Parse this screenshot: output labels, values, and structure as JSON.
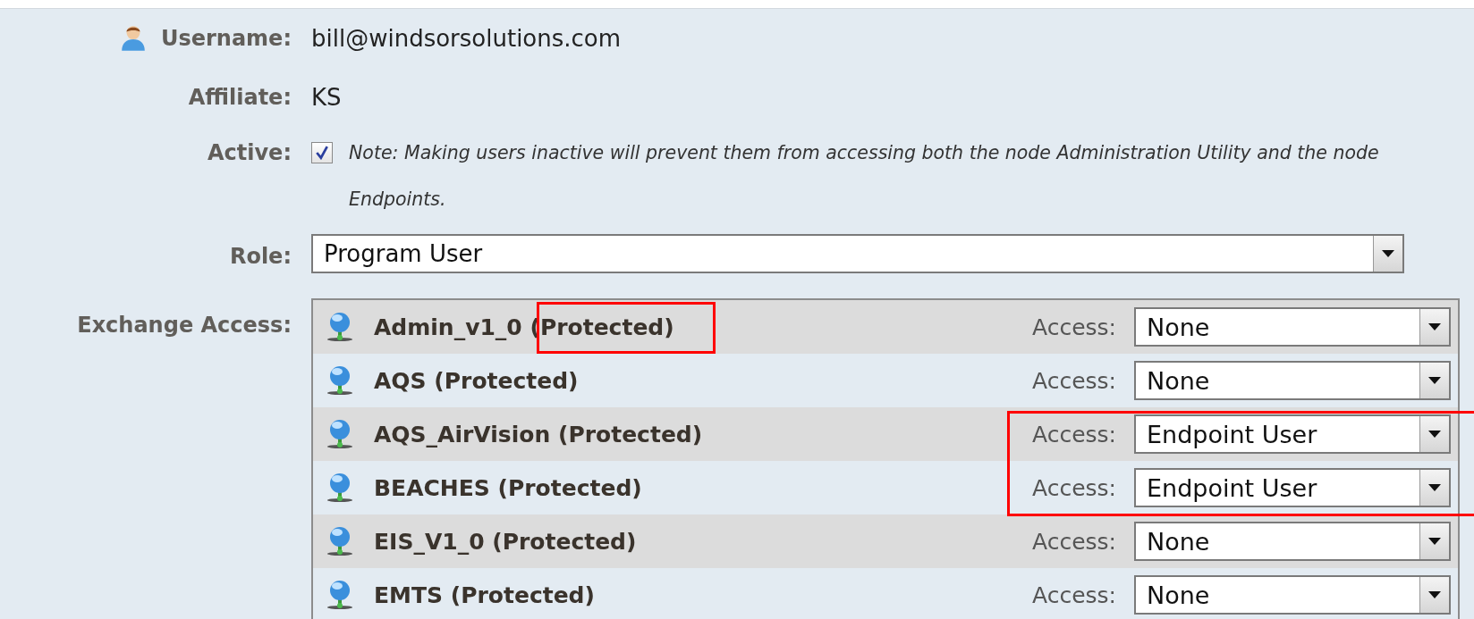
{
  "form": {
    "username": {
      "label": "Username:",
      "value": "bill@windsorsolutions.com"
    },
    "affiliate": {
      "label": "Affiliate:",
      "value": "KS"
    },
    "active": {
      "label": "Active:",
      "checked": true,
      "note": "Note: Making users inactive will prevent them from accessing both the node Administration Utility and the node Endpoints."
    },
    "role": {
      "label": "Role:",
      "value": "Program User"
    },
    "exchange_access": {
      "label": "Exchange Access:",
      "rows": [
        {
          "name": "Admin_v1_0 (Protected)",
          "access_label": "Access:",
          "access": "None",
          "name_framed": true,
          "access_framed": false
        },
        {
          "name": "AQS (Protected)",
          "access_label": "Access:",
          "access": "None",
          "name_framed": false,
          "access_framed": false
        },
        {
          "name": "AQS_AirVision (Protected)",
          "access_label": "Access:",
          "access": "Endpoint User",
          "name_framed": false,
          "access_framed": true
        },
        {
          "name": "BEACHES (Protected)",
          "access_label": "Access:",
          "access": "Endpoint User",
          "name_framed": false,
          "access_framed": true
        },
        {
          "name": "EIS_V1_0 (Protected)",
          "access_label": "Access:",
          "access": "None",
          "name_framed": false,
          "access_framed": false
        },
        {
          "name": "EMTS (Protected)",
          "access_label": "Access:",
          "access": "None",
          "name_framed": false,
          "access_framed": false
        }
      ]
    }
  }
}
